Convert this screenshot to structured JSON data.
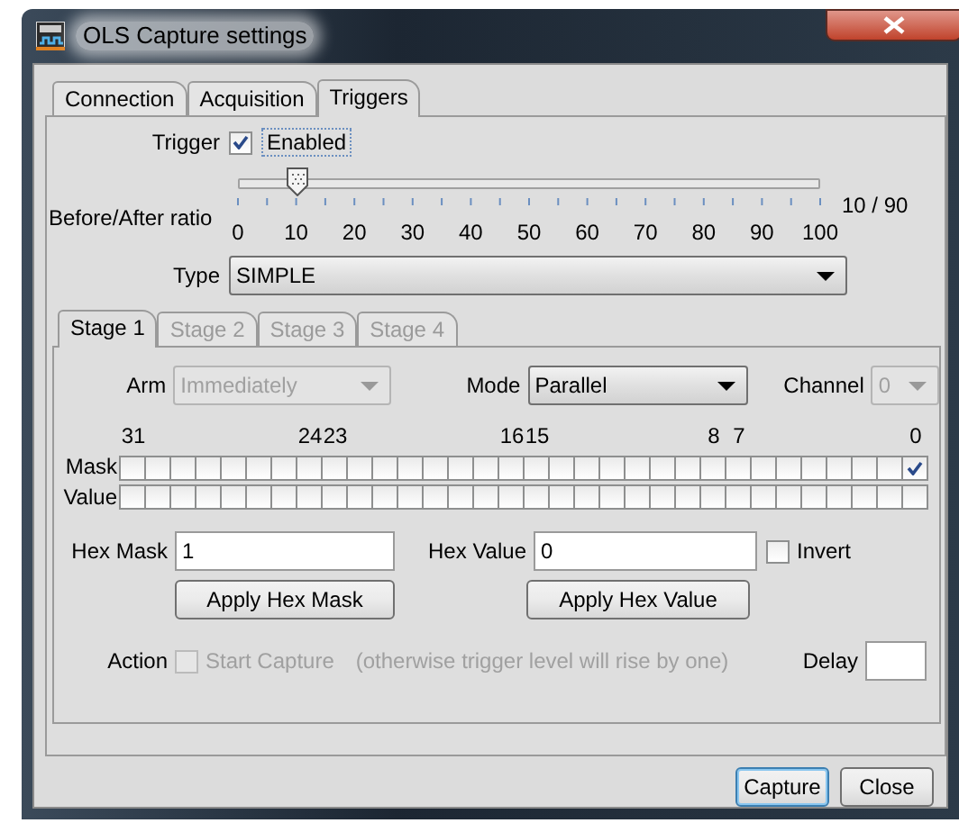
{
  "window": {
    "title": "OLS Capture settings"
  },
  "tabs": [
    {
      "label": "Connection",
      "selected": false
    },
    {
      "label": "Acquisition",
      "selected": false
    },
    {
      "label": "Triggers",
      "selected": true
    }
  ],
  "trigger": {
    "label": "Trigger",
    "option": {
      "label": "Enabled",
      "checked": true
    }
  },
  "ratio": {
    "label": "Before/After ratio",
    "level": 0.1,
    "ticks": [
      "0",
      "10",
      "20",
      "30",
      "40",
      "50",
      "60",
      "70",
      "80",
      "90",
      "100"
    ],
    "reading": "10 / 90"
  },
  "type": {
    "label": "Type",
    "value": "SIMPLE"
  },
  "stages": [
    {
      "label": "Stage 1",
      "selected": true,
      "disabled": false
    },
    {
      "label": "Stage 2",
      "selected": false,
      "disabled": true
    },
    {
      "label": "Stage 3",
      "selected": false,
      "disabled": true
    },
    {
      "label": "Stage 4",
      "selected": false,
      "disabled": true
    }
  ],
  "arm": {
    "label": "Arm",
    "value": "Immediately",
    "disabled": true
  },
  "mode": {
    "label": "Mode",
    "value": "Parallel",
    "disabled": false
  },
  "channel": {
    "label": "Channel",
    "value": "0",
    "disabled": true
  },
  "bit_labels": [
    "31",
    "24",
    "23",
    "16",
    "15",
    "8",
    "7",
    "0"
  ],
  "bit_rows": [
    {
      "label": "Mask",
      "bits": [
        false,
        false,
        false,
        false,
        false,
        false,
        false,
        false,
        false,
        false,
        false,
        false,
        false,
        false,
        false,
        false,
        false,
        false,
        false,
        false,
        false,
        false,
        false,
        false,
        false,
        false,
        false,
        false,
        false,
        false,
        false,
        true
      ]
    },
    {
      "label": "Value",
      "bits": [
        false,
        false,
        false,
        false,
        false,
        false,
        false,
        false,
        false,
        false,
        false,
        false,
        false,
        false,
        false,
        false,
        false,
        false,
        false,
        false,
        false,
        false,
        false,
        false,
        false,
        false,
        false,
        false,
        false,
        false,
        false,
        false
      ]
    }
  ],
  "hex_mask": {
    "label": "Hex Mask",
    "value": "1",
    "button": "Apply Hex Mask"
  },
  "hex_value": {
    "label": "Hex Value",
    "value": "0",
    "button": "Apply Hex Value"
  },
  "invert": {
    "label": "Invert",
    "checked": false
  },
  "action": {
    "label": "Action",
    "option": {
      "label": "Start Capture",
      "checked": false,
      "disabled": true
    },
    "note": "(otherwise trigger level will rise by one)"
  },
  "delay": {
    "label": "Delay"
  },
  "buttons": [
    {
      "label": "Capture",
      "default": true
    },
    {
      "label": "Close",
      "default": false
    }
  ]
}
